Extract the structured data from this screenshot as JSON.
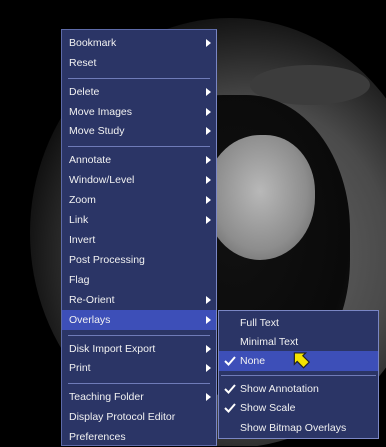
{
  "main_menu": {
    "items": [
      {
        "label": "Bookmark",
        "submenu": true
      },
      {
        "label": "Reset",
        "submenu": false
      },
      {
        "label": "Delete",
        "submenu": true
      },
      {
        "label": "Move Images",
        "submenu": true
      },
      {
        "label": "Move Study",
        "submenu": true
      },
      {
        "label": "Annotate",
        "submenu": true
      },
      {
        "label": "Window/Level",
        "submenu": true
      },
      {
        "label": "Zoom",
        "submenu": true
      },
      {
        "label": "Link",
        "submenu": true
      },
      {
        "label": "Invert",
        "submenu": false
      },
      {
        "label": "Post Processing",
        "submenu": false
      },
      {
        "label": "Flag",
        "submenu": false
      },
      {
        "label": "Re-Orient",
        "submenu": true
      },
      {
        "label": "Overlays",
        "submenu": true,
        "highlighted": true
      },
      {
        "label": "Disk Import Export",
        "submenu": true
      },
      {
        "label": "Print",
        "submenu": true
      },
      {
        "label": "Teaching Folder",
        "submenu": true
      },
      {
        "label": "Display Protocol Editor",
        "submenu": false
      },
      {
        "label": "Preferences",
        "submenu": false
      }
    ]
  },
  "overlays_submenu": {
    "items": [
      {
        "label": "Full Text",
        "checked": false
      },
      {
        "label": "Minimal Text",
        "checked": false
      },
      {
        "label": "None",
        "checked": true,
        "highlighted": true
      },
      {
        "label": "Show Annotation",
        "checked": true
      },
      {
        "label": "Show Scale",
        "checked": true
      },
      {
        "label": "Show Bitmap Overlays",
        "checked": false
      }
    ]
  },
  "colors": {
    "menu_bg": "#2b3566",
    "highlight": "#3d4fb8",
    "cursor": "#f5e400"
  },
  "icons": {
    "submenu": "triangle-right-icon",
    "check": "checkmark-icon",
    "cursor": "arrow-cursor-icon"
  }
}
